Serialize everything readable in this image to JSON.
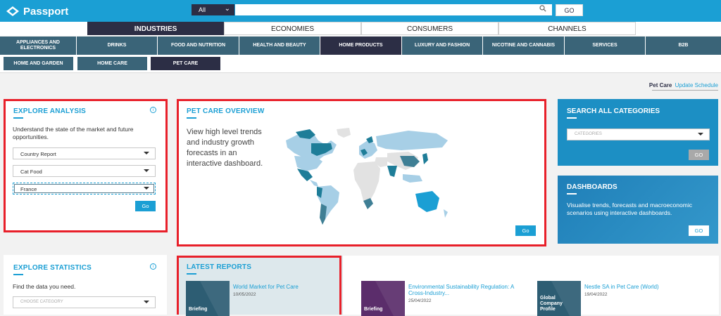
{
  "app": {
    "name": "Passport"
  },
  "search": {
    "scope": "All",
    "placeholder": "",
    "go": "GO"
  },
  "tier1": [
    "INDUSTRIES",
    "ECONOMIES",
    "CONSUMERS",
    "CHANNELS"
  ],
  "tier2": [
    "APPLIANCES AND ELECTRONICS",
    "DRINKS",
    "FOOD AND NUTRITION",
    "HEALTH AND BEAUTY",
    "HOME PRODUCTS",
    "LUXURY AND FASHION",
    "NICOTINE AND CANNABIS",
    "SERVICES",
    "B2B"
  ],
  "tier3": [
    "HOME AND GARDEN",
    "HOME CARE",
    "PET CARE"
  ],
  "update": {
    "category": "Pet Care",
    "link": "Update Schedule"
  },
  "explore_analysis": {
    "title": "EXPLORE ANALYSIS",
    "description": "Understand the state of the market and future opportunities.",
    "report_type": "Country Report",
    "category": "Cat Food",
    "geography": "France",
    "go": "Go"
  },
  "overview": {
    "title": "PET CARE OVERVIEW",
    "description": "View high level trends and industry growth forecasts in an interactive dashboard.",
    "go": "Go"
  },
  "search_categories": {
    "title": "SEARCH ALL CATEGORIES",
    "placeholder": "CATEGORIES",
    "go": "GO"
  },
  "dashboards": {
    "title": "DASHBOARDS",
    "description": "Visualise trends, forecasts and macroeconomic scenarios using interactive dashboards.",
    "go": "GO"
  },
  "explore_statistics": {
    "title": "EXPLORE STATISTICS",
    "description": "Find the data you need.",
    "placeholder": "CHOOSE CATEGORY"
  },
  "latest_reports": {
    "title": "LATEST REPORTS",
    "items": [
      {
        "type": "Briefing",
        "title": "World Market for Pet Care",
        "date": "10/05/2022",
        "color": "#2d5d73"
      },
      {
        "type": "Briefing",
        "title": "Environmental Sustainability Regulation: A Cross-Industry...",
        "date": "25/04/2022",
        "color": "#5b2d6b"
      },
      {
        "type": "Global Company Profile",
        "title": "Nestle SA in Pet Care (World)",
        "date": "19/04/2022",
        "color": "#2d5d73"
      }
    ]
  },
  "colors": {
    "brand": "#1b9fd4",
    "navy": "#2c2e45",
    "nav": "#3a6478",
    "highlight": "#e8202a"
  }
}
